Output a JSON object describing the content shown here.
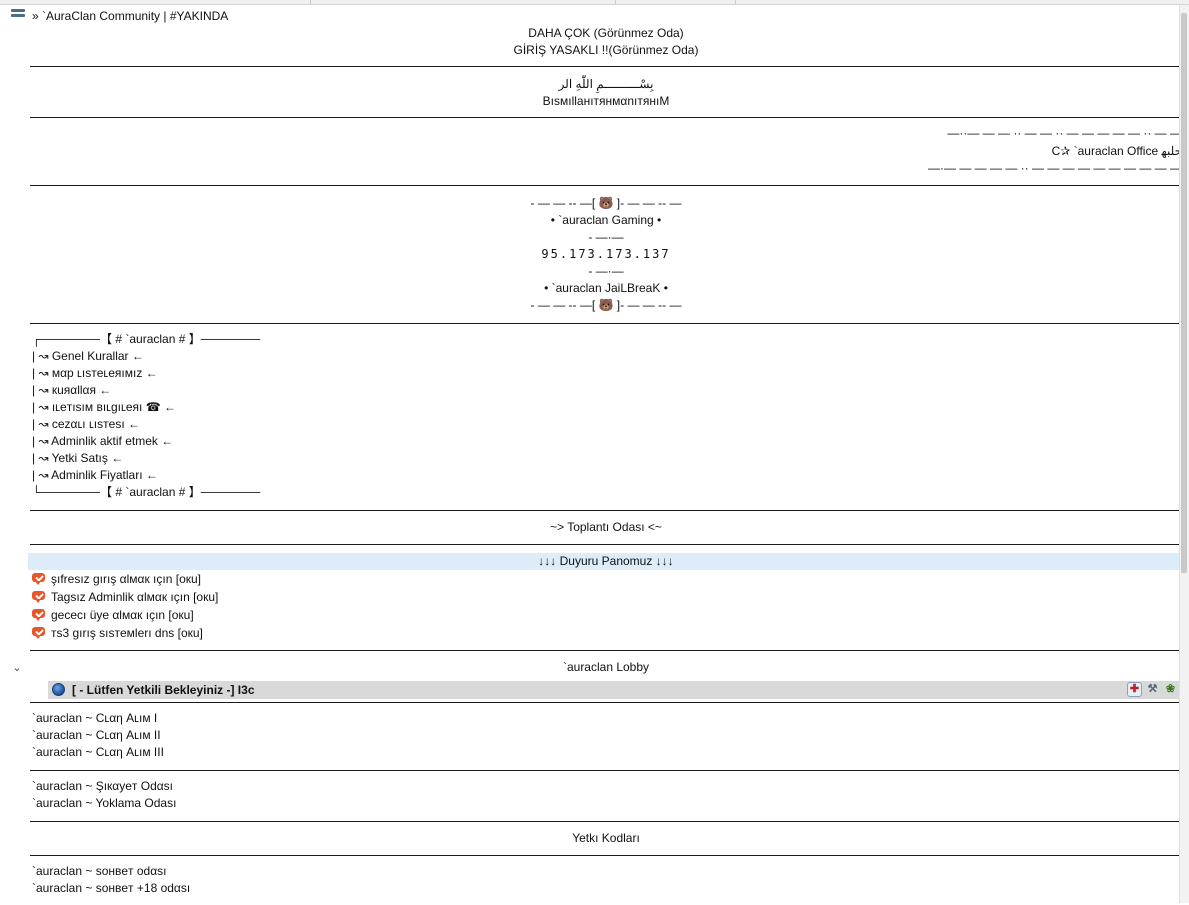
{
  "server": {
    "name": "» `AuraClan Community | #YAKINDA",
    "icon": "server-icon"
  },
  "header": {
    "line1": "DAHA ÇOK (Görünmez Oda)",
    "line2": "GİRİŞ YASAKLI !!(Görünmez Oda)"
  },
  "bismillah": {
    "arabic": "بِسْــــــــــمِ اللّٰهِ الر",
    "latin": "BısмıllанıтянмαnıтянıM"
  },
  "office": {
    "top_line": "—··— — — ·· — — ·· — — — — — ·· — —",
    "name": "C✰ `auraclan Office ﺣﻠﺒﻬ",
    "bottom_line": "—·— — — — — ·· — — — — — — — — — —"
  },
  "gaming": {
    "frame_top": "- — — -- —[ 🐻 ]- — — -- —",
    "name": "• `auraclan Gaming •",
    "dash1": "- —·—",
    "ip": "95.173.173.137",
    "dash2": "- —·—",
    "jail": "• `auraclan JaiLBreaK •",
    "frame_bottom": "- — — -- —[ 🐻 ]- — — -- —"
  },
  "menu": {
    "top": "┌───────【 # `auraclan # 】───────",
    "items": [
      "| ↝ Genel Kurallar ←",
      "| ↝ мαp ʟısтeʟeяıмız ←",
      "| ↝ кuяαllαя ←",
      "| ↝ ıʟeтısıм вıʟgıʟeяı ☎ ←",
      "| ↝ cezαʟı ʟısтesı ←",
      "| ↝ Adminlik aktif etmek ←",
      "| ↝ Yetki Satış ←",
      "| ↝ Adminlik Fiyatları ←"
    ],
    "bottom": "└───────【 # `auraclan # 】───────"
  },
  "meeting_room": "~> Toplantı Odası <~",
  "announcement": {
    "title": "↓↓↓  Duyuru Panomuz  ↓↓↓",
    "items": [
      "şıfresız gırış αlмαк ıçın [oкu]",
      "Tagsız Adminlik αlмαк ıçın [oкu]",
      "gececı üye αlмαк ıçın [oкu]",
      "тs3 gırış sısтeмlerı dns [oкu]"
    ],
    "icon": "channel-chat-icon"
  },
  "lobby": {
    "title": "`auraclan Lobby",
    "expand_icon": "chevron-down-icon",
    "client": {
      "name": "[ - Lütfen Yetkili Bekleyiniz -] I3c",
      "icon": "client-status-icon",
      "badges": [
        "server-admin-badge-icon",
        "tools-badge-icon",
        "leaf-badge-icon"
      ]
    }
  },
  "clan_rooms": [
    "`auraclan ~ Cʟαη Aʟıм I",
    "`auraclan ~ Cʟαη Aʟıм II",
    "`auraclan ~ Cʟαη Aʟıм III"
  ],
  "misc_rooms": [
    "`auraclan ~ Şıкαyeт Odαsı",
    "`auraclan ~ Yoklama Odası"
  ],
  "codes_title": "Yetkı Kodları",
  "chat_rooms": [
    "`auraclan ~ soнвeт odαsı",
    "`auraclan ~ soнвeт +18 odαsı"
  ]
}
